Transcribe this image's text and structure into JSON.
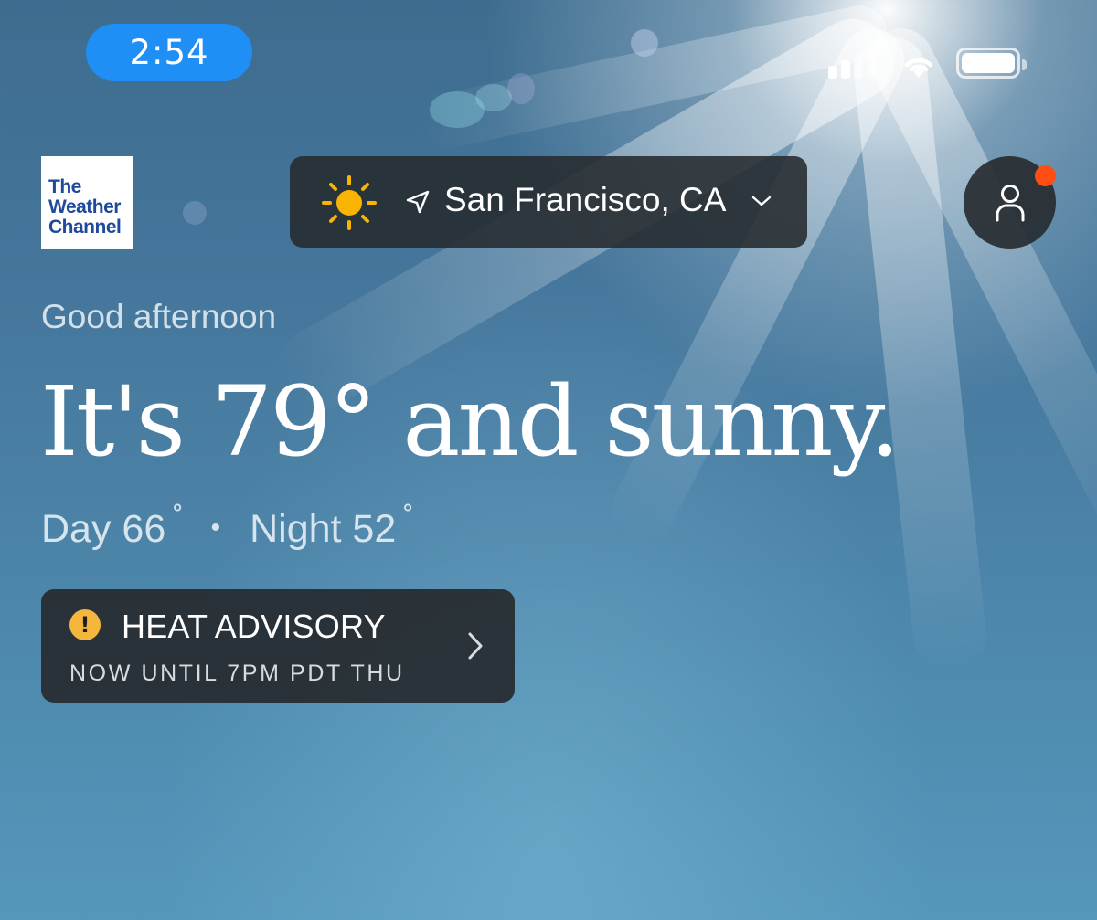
{
  "status_bar": {
    "time": "2:54"
  },
  "brand": {
    "logo_lines": [
      "The",
      "Weather",
      "Channel"
    ]
  },
  "location": {
    "name": "San Francisco, CA",
    "condition_icon": "sun-icon",
    "location_icon": "location-arrow-icon",
    "dropdown_icon": "chevron-down-icon"
  },
  "profile": {
    "icon": "person-icon",
    "has_notification": true,
    "notification_color": "#ff4e14"
  },
  "hero": {
    "greeting": "Good afternoon",
    "headline": "It's 79° and sunny.",
    "day_label": "Day 66",
    "night_label": "Night 52",
    "degree_symbol": "˚",
    "separator": "•"
  },
  "alert": {
    "title": "HEAT ADVISORY",
    "subtitle": "NOW UNTIL 7PM PDT THU",
    "icon": "warning-icon",
    "icon_glyph": "!",
    "icon_color": "#f4b63d",
    "chevron_icon": "chevron-right-icon"
  },
  "colors": {
    "time_pill": "#1f8ff5",
    "logo_blue": "#1f4a9b",
    "sun_yellow": "#f8b400",
    "card_dark": "#26292e"
  }
}
